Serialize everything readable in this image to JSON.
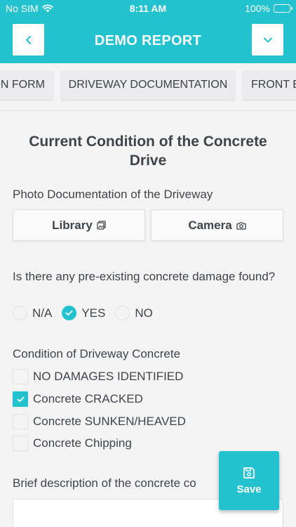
{
  "status_bar": {
    "carrier": "No SIM",
    "time": "8:11 AM",
    "battery": "100%"
  },
  "header": {
    "title": "DEMO REPORT",
    "back_icon": "chevron-left-icon",
    "menu_icon": "chevron-down-icon"
  },
  "tabs": [
    {
      "label": "ON FORM"
    },
    {
      "label": "DRIVEWAY DOCUMENTATION",
      "active": true
    },
    {
      "label": "FRONT E"
    }
  ],
  "section": {
    "title": "Current Condition of the Concrete Drive",
    "photo_label": "Photo Documentation of the Driveway",
    "library_label": "Library",
    "camera_label": "Camera",
    "damage_question": "Is there any pre-existing concrete damage found?",
    "damage_options": [
      {
        "label": "N/A",
        "selected": false
      },
      {
        "label": "YES",
        "selected": true
      },
      {
        "label": "NO",
        "selected": false
      }
    ],
    "condition_label": "Condition of Driveway Concrete",
    "condition_options": [
      {
        "label": "NO DAMAGES IDENTIFIED",
        "checked": false
      },
      {
        "label": "Concrete CRACKED",
        "checked": true
      },
      {
        "label": "Concrete SUNKEN/HEAVED",
        "checked": false
      },
      {
        "label": "Concrete Chipping",
        "checked": false
      }
    ],
    "description_label": "Brief description of the concrete co"
  },
  "save": {
    "label": "Save",
    "icon": "save-icon"
  },
  "colors": {
    "accent": "#22c2cf",
    "background": "#f4f4f5",
    "text": "#3f4449"
  }
}
